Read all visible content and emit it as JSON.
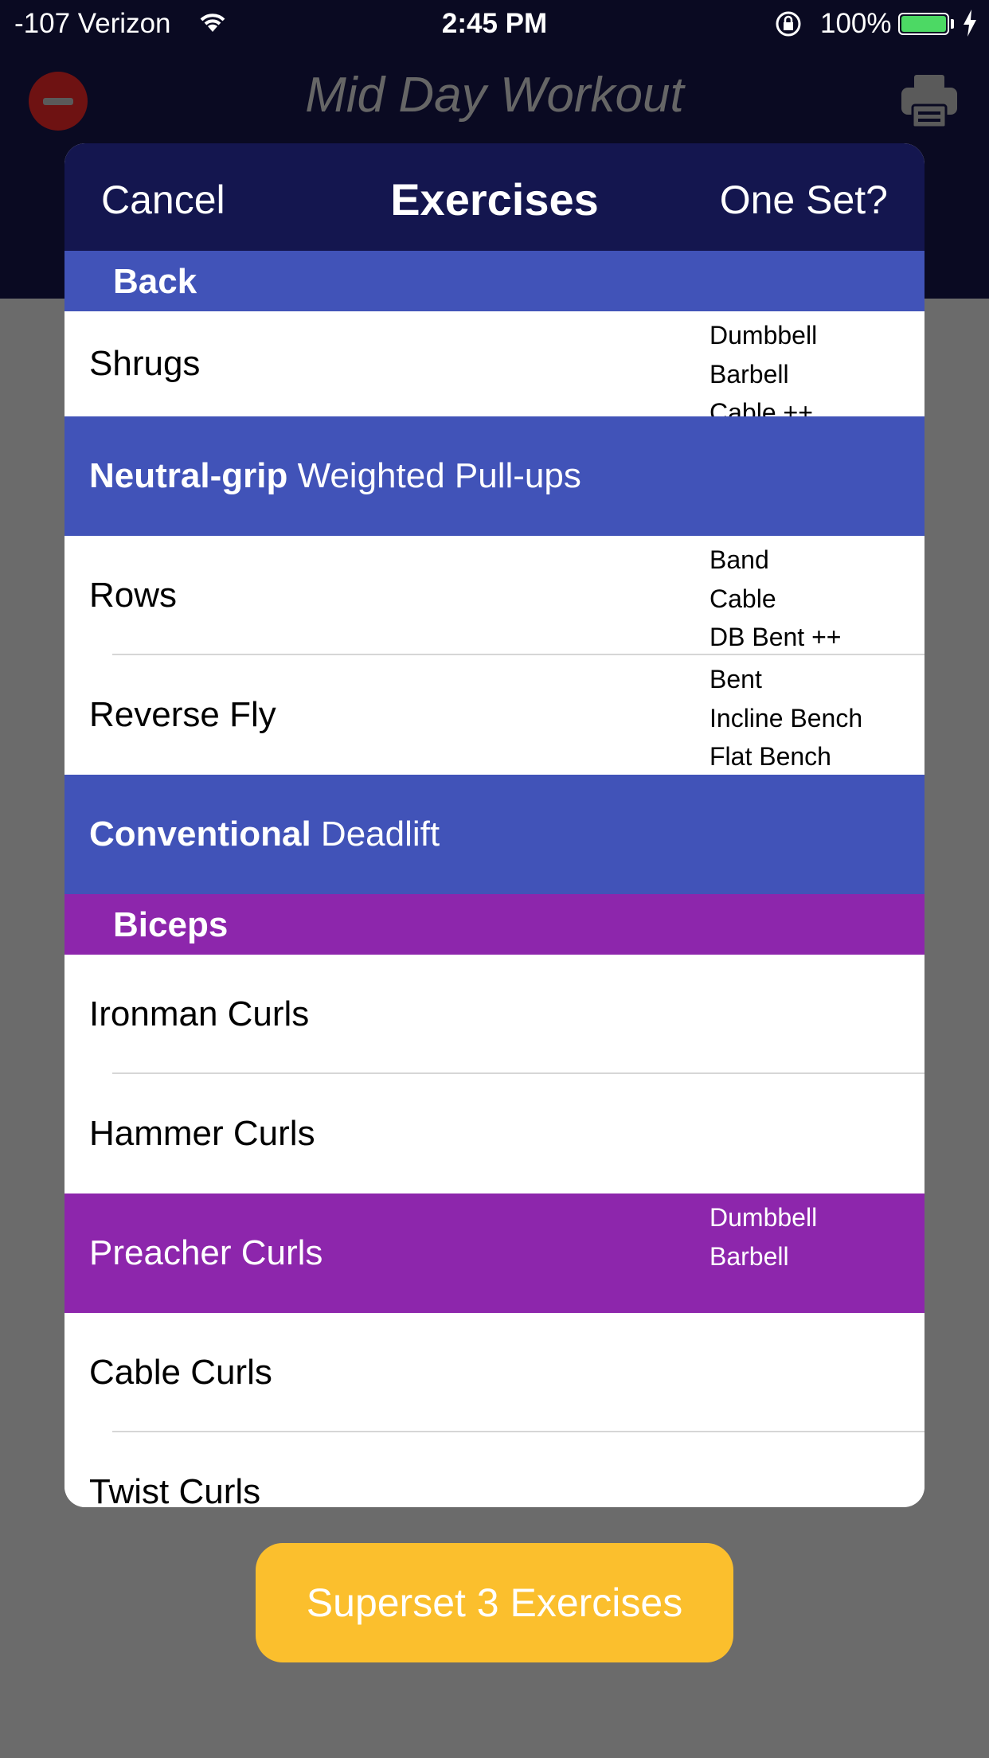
{
  "status_bar": {
    "carrier": "-107 Verizon",
    "time": "2:45 PM",
    "battery": "100%"
  },
  "app": {
    "title": "Mid Day Workout"
  },
  "sheet": {
    "cancel_label": "Cancel",
    "title": "Exercises",
    "one_set_label": "One Set?"
  },
  "sections": [
    {
      "title": "Back",
      "rows": [
        {
          "name": "Shrugs",
          "variants": [
            "Dumbbell",
            "Barbell",
            "Cable ++"
          ]
        },
        {
          "prefix": "Neutral-grip",
          "name": "Weighted Pull-ups",
          "highlighted": true
        },
        {
          "name": "Rows",
          "variants": [
            "Band",
            "Cable",
            "DB Bent ++"
          ]
        },
        {
          "name": "Reverse Fly",
          "variants": [
            "Bent",
            "Incline Bench",
            "Flat Bench"
          ]
        },
        {
          "prefix": "Conventional",
          "name": "Deadlift",
          "highlighted": true
        }
      ]
    },
    {
      "title": "Biceps",
      "rows": [
        {
          "name": "Ironman Curls"
        },
        {
          "name": "Hammer Curls"
        },
        {
          "name": "Preacher Curls",
          "variants": [
            "Dumbbell",
            "Barbell"
          ],
          "highlighted": true
        },
        {
          "name": "Cable Curls"
        },
        {
          "name": "Twist Curls"
        }
      ]
    }
  ],
  "superset_button": "Superset 3 Exercises",
  "colors": {
    "background": "#6b6b6b",
    "header": "#0a0a22",
    "sheet_header": "#14164f",
    "back_accent": "#4153b8",
    "biceps_accent": "#8d26ac",
    "superset": "#fbbf2d"
  }
}
